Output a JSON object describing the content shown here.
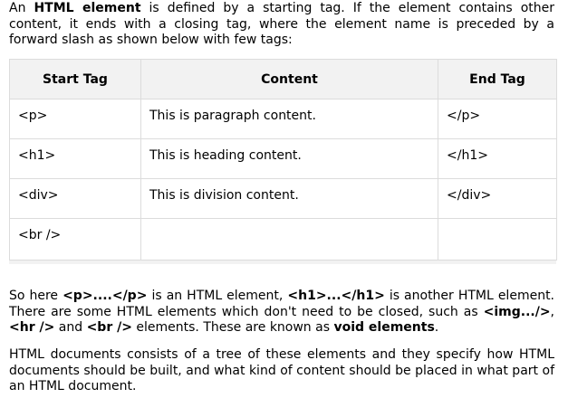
{
  "intro": {
    "t1": "An ",
    "b1": "HTML element",
    "t2": " is defined by a starting tag. If the element contains other content, it ends with a closing tag, where the element name is preceded by a forward slash as shown below with few tags:"
  },
  "table": {
    "headers": [
      "Start Tag",
      "Content",
      "End Tag"
    ],
    "rows": [
      [
        "<p>",
        "This is paragraph content.",
        "</p>"
      ],
      [
        "<h1>",
        "This is heading content.",
        "</h1>"
      ],
      [
        "<div>",
        "This is division content.",
        "</div>"
      ],
      [
        "<br />",
        "",
        ""
      ]
    ]
  },
  "para2": {
    "t1": "So here ",
    "b1": "<p>....</p>",
    "t2": " is an HTML element, ",
    "b2": "<h1>...</h1>",
    "t3": " is another HTML element. There are some HTML elements which don't need to be closed, such as ",
    "b3": "<img.../>",
    "t4": ", ",
    "b4": "<hr />",
    "t5": " and ",
    "b5": "<br />",
    "t6": " elements. These are known as ",
    "b6": "void elements",
    "t7": "."
  },
  "para3": {
    "text": "HTML documents consists of a tree of these elements and they specify how HTML documents should be built, and what kind of content should be placed in what part of an HTML document."
  }
}
